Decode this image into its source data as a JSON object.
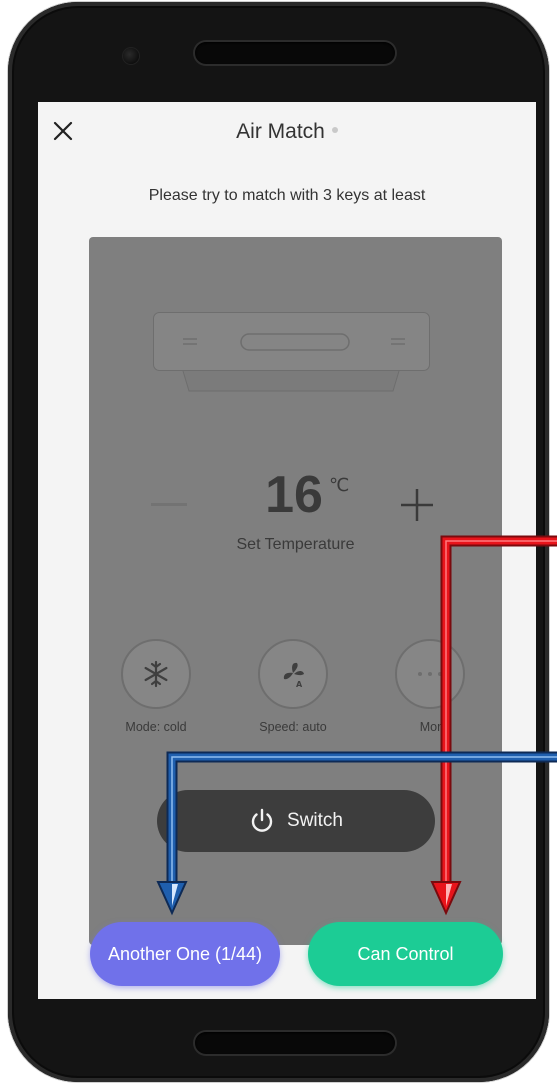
{
  "header": {
    "title": "Air Match",
    "close_icon": "close-icon",
    "subtitle": "Please try to match with 3 keys at least"
  },
  "remote": {
    "temperature": "16",
    "temperature_unit": "℃",
    "temperature_label": "Set Temperature",
    "modes": [
      {
        "label": "Mode: cold",
        "icon": "snowflake-icon"
      },
      {
        "label": "Speed: auto",
        "icon": "fan-auto-icon"
      },
      {
        "label": "More",
        "icon": "more-icon"
      }
    ],
    "switch_label": "Switch",
    "switch_icon": "power-icon"
  },
  "actions": {
    "another_label": "Another One (1/44)",
    "control_label": "Can Control"
  },
  "colors": {
    "another_button": "#7071ea",
    "control_button": "#1ccc95",
    "red_arrow": "#e8141b",
    "blue_arrow": "#1f5fae"
  }
}
